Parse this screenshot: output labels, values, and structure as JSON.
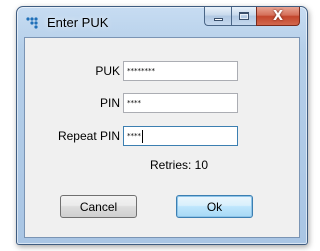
{
  "window": {
    "title": "Enter PUK",
    "icon": "dots-app-icon"
  },
  "caption": {
    "minimize_icon": "minimize-icon",
    "maximize_icon": "maximize-icon",
    "close_icon": "close-icon",
    "close_glyph": "X"
  },
  "form": {
    "puk_label": "PUK",
    "puk_value": "********",
    "pin_label": "PIN",
    "pin_value": "****",
    "repeat_pin_label": "Repeat PIN",
    "repeat_pin_value": "****",
    "retries_text": "Retries: 10"
  },
  "buttons": {
    "cancel_label": "Cancel",
    "ok_label": "Ok"
  }
}
